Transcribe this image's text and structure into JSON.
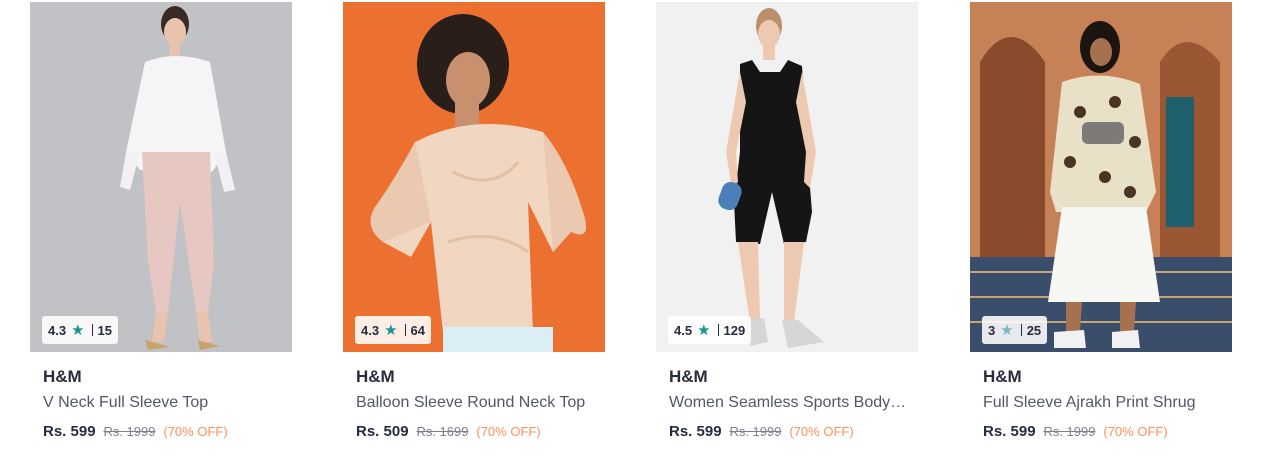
{
  "products": [
    {
      "image": "woman in white ruffled top and pink trousers",
      "rating": "4.3",
      "count": "15",
      "brand": "H&M",
      "name": "V Neck Full Sleeve Top",
      "price": "Rs. 599",
      "mrp": "Rs. 1999",
      "discount": "(70% OFF)"
    },
    {
      "image": "woman in champagne satin balloon sleeve top on orange background",
      "rating": "4.3",
      "count": "64",
      "brand": "H&M",
      "name": "Balloon Sleeve Round Neck Top",
      "price": "Rs. 509",
      "mrp": "Rs. 1699",
      "discount": "(70% OFF)"
    },
    {
      "image": "woman in black seamless sports bodysuit",
      "rating": "4.5",
      "count": "129",
      "brand": "H&M",
      "name": "Women Seamless Sports Body…",
      "price": "Rs. 599",
      "mrp": "Rs. 1999",
      "discount": "(70% OFF)"
    },
    {
      "image": "woman in ajrakh print shrug and white skirt in terracotta archway",
      "rating": "3",
      "count": "25",
      "brand": "H&M",
      "name": "Full Sleeve Ajrakh Print Shrug",
      "price": "Rs. 599",
      "mrp": "Rs. 1999",
      "discount": "(70% OFF)"
    }
  ],
  "colors": {
    "star": "#14958f",
    "discount": "#ff905a",
    "text": "#282c3f"
  }
}
